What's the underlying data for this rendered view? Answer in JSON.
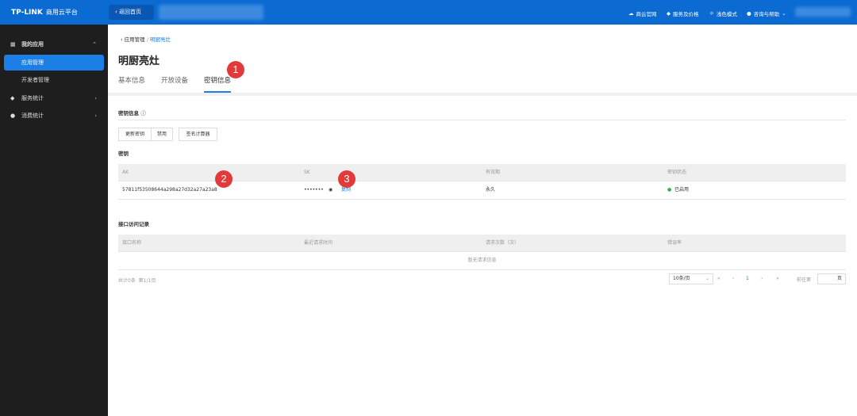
{
  "topbar": {
    "brand": "TP-LINK",
    "product": "商用云平台",
    "back_label": "返回首页",
    "nav": [
      {
        "icon": "cloud-icon",
        "label": "商云官网"
      },
      {
        "icon": "diamond-icon",
        "label": "服务及价格"
      },
      {
        "icon": "sun-icon",
        "label": "浅色模式"
      },
      {
        "icon": "info-icon",
        "label": "咨询与帮助"
      }
    ],
    "brand_color": "#0b6bd3"
  },
  "sidebar": {
    "items": [
      {
        "icon": "grid-icon",
        "label": "我的应用",
        "expanded": true
      },
      {
        "label": "应用管理",
        "active": true
      },
      {
        "label": "开发者管理"
      },
      {
        "icon": "diamond-icon",
        "label": "服务统计"
      },
      {
        "icon": "coin-icon",
        "label": "消费统计"
      }
    ]
  },
  "breadcrumb": {
    "parent": "应用管理",
    "separator": "/",
    "current": "明厨亮灶"
  },
  "page_title": "明厨亮灶",
  "tabs": [
    {
      "label": "基本信息"
    },
    {
      "label": "开放设备"
    },
    {
      "label": "密钥信息",
      "active": true
    }
  ],
  "key_section": {
    "title": "密钥信息",
    "buttons": [
      "更新密钥",
      "禁用",
      "签名计算器"
    ],
    "subtitle": "密钥",
    "columns": [
      "AK",
      "SK",
      "有效期",
      "密钥状态"
    ],
    "row": {
      "ak": "57811f53508644a298a27d32a27a23a8",
      "sk": "•••••••",
      "copy": "复制",
      "validity": "永久",
      "status": "已启用",
      "status_color": "#22b14c"
    }
  },
  "log_section": {
    "title": "接口访问记录",
    "columns": [
      "接口名称",
      "最近请求时间",
      "请求次数（次）",
      "错误率"
    ],
    "empty": "暂无请求信息",
    "total": "共计0条",
    "page_info": "第1/1页",
    "page_size": "10条/页",
    "current_page": "1",
    "goto_label": "前往第",
    "page_unit": "页"
  },
  "annotations": [
    "1",
    "2",
    "3"
  ]
}
